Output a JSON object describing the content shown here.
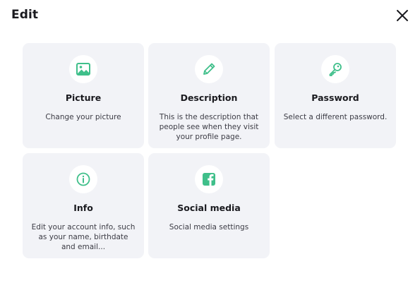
{
  "dialog": {
    "title": "Edit"
  },
  "accent_color": "#3fbf8a",
  "cards": [
    {
      "icon": "image-icon",
      "title": "Picture",
      "description": "Change your picture"
    },
    {
      "icon": "pencil-icon",
      "title": "Description",
      "description": "This is the description that people see when they visit your profile page."
    },
    {
      "icon": "key-icon",
      "title": "Password",
      "description": "Select a different password."
    },
    {
      "icon": "info-icon",
      "title": "Info",
      "description": "Edit your account info, such as your name, birthdate and email..."
    },
    {
      "icon": "facebook-icon",
      "title": "Social media",
      "description": "Social media settings"
    }
  ]
}
